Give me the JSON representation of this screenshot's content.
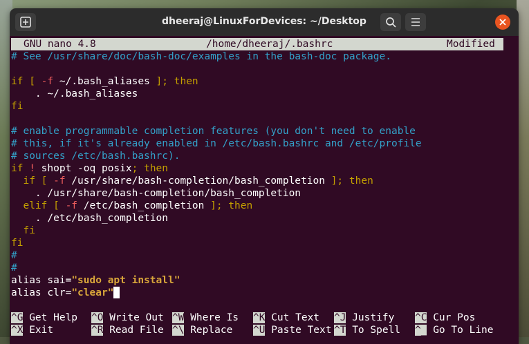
{
  "window": {
    "title": "dheeraj@LinuxForDevices: ~/Desktop",
    "new_tab_icon": "new-tab-icon",
    "search_icon": "search-icon",
    "menu_icon": "hamburger-menu-icon",
    "close_icon": "close-icon"
  },
  "nano": {
    "version": "GNU nano 4.8",
    "file": "/home/dheeraj/.bashrc",
    "status": "Modified"
  },
  "editor": {
    "l1": "# See /usr/share/doc/bash-doc/examples in the bash-doc package.",
    "l3_a": "if [ ",
    "l3_b": "-f",
    "l3_c": " ~/.bash_aliases",
    "l3_d": " ]; then",
    "l4": "    . ~/.bash_aliases",
    "l5": "fi",
    "l7": "# enable programmable completion features (you don't need to enable",
    "l8": "# this, if it's already enabled in /etc/bash.bashrc and /etc/profile",
    "l9": "# sources /etc/bash.bashrc).",
    "l10_a": "if",
    "l10_b": " ! ",
    "l10_c": "shopt -oq posix",
    "l10_d": "; then",
    "l11_a": "  if [ ",
    "l11_b": "-f",
    "l11_c": " /usr/share/bash-completion/bash_completion",
    "l11_d": " ]; then",
    "l12": "    . /usr/share/bash-completion/bash_completion",
    "l13_a": "  elif [ ",
    "l13_b": "-f",
    "l13_c": " /etc/bash_completion",
    "l13_d": " ]; then",
    "l14": "    . /etc/bash_completion",
    "l15": "  fi",
    "l16": "fi",
    "l17": "#",
    "l18": "#",
    "l19_a": "alias sai=",
    "l19_b": "\"sudo apt install\"",
    "l20_a": "alias clr=",
    "l20_b": "\"clear\""
  },
  "shortcuts": [
    {
      "key": "^G",
      "label": "Get Help"
    },
    {
      "key": "^O",
      "label": "Write Out"
    },
    {
      "key": "^W",
      "label": "Where Is"
    },
    {
      "key": "^K",
      "label": "Cut Text"
    },
    {
      "key": "^J",
      "label": "Justify"
    },
    {
      "key": "^C",
      "label": "Cur Pos"
    },
    {
      "key": "^X",
      "label": "Exit"
    },
    {
      "key": "^R",
      "label": "Read File"
    },
    {
      "key": "^\\",
      "label": "Replace"
    },
    {
      "key": "^U",
      "label": "Paste Text"
    },
    {
      "key": "^T",
      "label": "To Spell"
    },
    {
      "key": "^_",
      "label": "Go To Line"
    }
  ],
  "colors": {
    "terminal_bg": "#300a24",
    "comment": "#33a1c9",
    "keyword": "#c4a000",
    "flag": "#ef5d5d",
    "close_button": "#e95420"
  }
}
